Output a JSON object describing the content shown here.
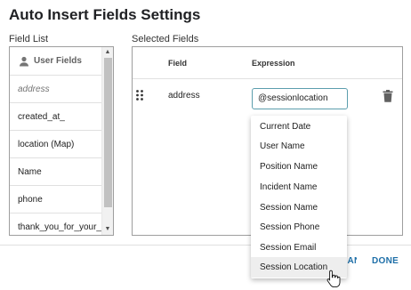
{
  "dialog": {
    "title": "Auto Insert Fields Settings"
  },
  "field_list": {
    "label": "Field List",
    "header": "User Fields",
    "items": [
      "address",
      "created_at_",
      "location (Map)",
      "Name",
      "phone",
      "thank_you_for_your_ti..."
    ]
  },
  "selected_fields": {
    "label": "Selected Fields",
    "columns": {
      "field": "Field",
      "expression": "Expression"
    },
    "rows": [
      {
        "field": "address",
        "expression": "@sessionlocation"
      }
    ]
  },
  "dropdown": {
    "options": [
      "Current Date",
      "User Name",
      "Position Name",
      "Incident Name",
      "Session Name",
      "Session Phone",
      "Session Email",
      "Session Location"
    ],
    "hovered": "Session Location"
  },
  "footer": {
    "cancel_label": "CANCEL",
    "done_label": "DONE"
  },
  "colors": {
    "accent": "#1e6fa8",
    "input_border": "#5c9ead"
  },
  "icons": {
    "user": "person-icon",
    "drag": "drag-handle-icon",
    "delete": "trash-icon",
    "cursor": "hand-pointer-icon"
  }
}
